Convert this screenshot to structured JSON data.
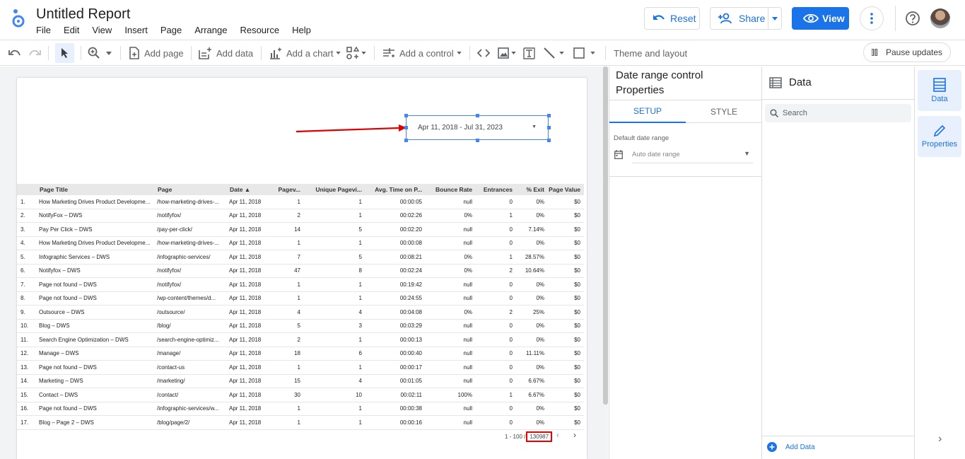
{
  "header": {
    "title": "Untitled Report",
    "menu": [
      "File",
      "Edit",
      "View",
      "Insert",
      "Page",
      "Arrange",
      "Resource",
      "Help"
    ],
    "reset_label": "Reset",
    "share_label": "Share",
    "view_label": "View"
  },
  "toolbar": {
    "add_page": "Add page",
    "add_data": "Add data",
    "add_chart": "Add a chart",
    "add_control": "Add a control",
    "theme_layout": "Theme and layout",
    "pause_updates": "Pause updates"
  },
  "date_control": {
    "value": "Apr 11, 2018 - Jul 31, 2023"
  },
  "table": {
    "headers": [
      "Page Title",
      "Page",
      "Date ▲",
      "Pagev...",
      "Unique Pagevi...",
      "Avg. Time on P...",
      "Bounce Rate",
      "Entrances",
      "% Exit",
      "Page Value"
    ],
    "rows": [
      [
        "1.",
        "How Marketing Drives Product Developme...",
        "/how-marketing-drives-...",
        "Apr 11, 2018",
        "1",
        "1",
        "00:00:05",
        "null",
        "0",
        "0%",
        "$0"
      ],
      [
        "2.",
        "NotifyFox – DWS",
        "/notifyfox/",
        "Apr 11, 2018",
        "2",
        "1",
        "00:02:26",
        "0%",
        "1",
        "0%",
        "$0"
      ],
      [
        "3.",
        "Pay Per Click – DWS",
        "/pay-per-click/",
        "Apr 11, 2018",
        "14",
        "5",
        "00:02:20",
        "null",
        "0",
        "7.14%",
        "$0"
      ],
      [
        "4.",
        "How Marketing Drives Product Developme...",
        "/how-marketing-drives-...",
        "Apr 11, 2018",
        "1",
        "1",
        "00:00:08",
        "null",
        "0",
        "0%",
        "$0"
      ],
      [
        "5.",
        "Infographic Services – DWS",
        "/infographic-services/",
        "Apr 11, 2018",
        "7",
        "5",
        "00:08:21",
        "0%",
        "1",
        "28.57%",
        "$0"
      ],
      [
        "6.",
        "Notifyfox – DWS",
        "/notifyfox/",
        "Apr 11, 2018",
        "47",
        "8",
        "00:02:24",
        "0%",
        "2",
        "10.64%",
        "$0"
      ],
      [
        "7.",
        "Page not found – DWS",
        "/notifyfox/",
        "Apr 11, 2018",
        "1",
        "1",
        "00:19:42",
        "null",
        "0",
        "0%",
        "$0"
      ],
      [
        "8.",
        "Page not found – DWS",
        "/wp-content/themes/d...",
        "Apr 11, 2018",
        "1",
        "1",
        "00:24:55",
        "null",
        "0",
        "0%",
        "$0"
      ],
      [
        "9.",
        "Outsource – DWS",
        "/outsource/",
        "Apr 11, 2018",
        "4",
        "4",
        "00:04:08",
        "0%",
        "2",
        "25%",
        "$0"
      ],
      [
        "10.",
        "Blog – DWS",
        "/blog/",
        "Apr 11, 2018",
        "5",
        "3",
        "00:03:29",
        "null",
        "0",
        "0%",
        "$0"
      ],
      [
        "11.",
        "Search Engine Optimization – DWS",
        "/search-engine-optimiz...",
        "Apr 11, 2018",
        "2",
        "1",
        "00:00:13",
        "null",
        "0",
        "0%",
        "$0"
      ],
      [
        "12.",
        "Manage – DWS",
        "/manage/",
        "Apr 11, 2018",
        "18",
        "6",
        "00:00:40",
        "null",
        "0",
        "11.11%",
        "$0"
      ],
      [
        "13.",
        "Page not found – DWS",
        "/contact-us",
        "Apr 11, 2018",
        "1",
        "1",
        "00:00:17",
        "null",
        "0",
        "0%",
        "$0"
      ],
      [
        "14.",
        "Marketing – DWS",
        "/marketing/",
        "Apr 11, 2018",
        "15",
        "4",
        "00:01:05",
        "null",
        "0",
        "6.67%",
        "$0"
      ],
      [
        "15.",
        "Contact – DWS",
        "/contact/",
        "Apr 11, 2018",
        "30",
        "10",
        "00:02:11",
        "100%",
        "1",
        "6.67%",
        "$0"
      ],
      [
        "16.",
        "Page not found – DWS",
        "/infographic-services/w...",
        "Apr 11, 2018",
        "1",
        "1",
        "00:00:38",
        "null",
        "0",
        "0%",
        "$0"
      ],
      [
        "17.",
        "Blog – Page 2 – DWS",
        "/blog/page/2/",
        "Apr 11, 2018",
        "1",
        "1",
        "00:00:16",
        "null",
        "0",
        "0%",
        "$0"
      ]
    ],
    "pager_range": "1 - 100 /",
    "pager_total": "130987"
  },
  "properties": {
    "title": "Date range control Properties",
    "tab_setup": "SETUP",
    "tab_style": "STYLE",
    "default_range_label": "Default date range",
    "default_range_value": "Auto date range"
  },
  "data_panel": {
    "title": "Data",
    "search_placeholder": "Search",
    "add_data": "Add Data"
  },
  "rail": {
    "data": "Data",
    "properties": "Properties"
  },
  "colors": {
    "accent": "#1a73e8",
    "highlight_box": "#e00000",
    "arrow": "#e00000"
  }
}
